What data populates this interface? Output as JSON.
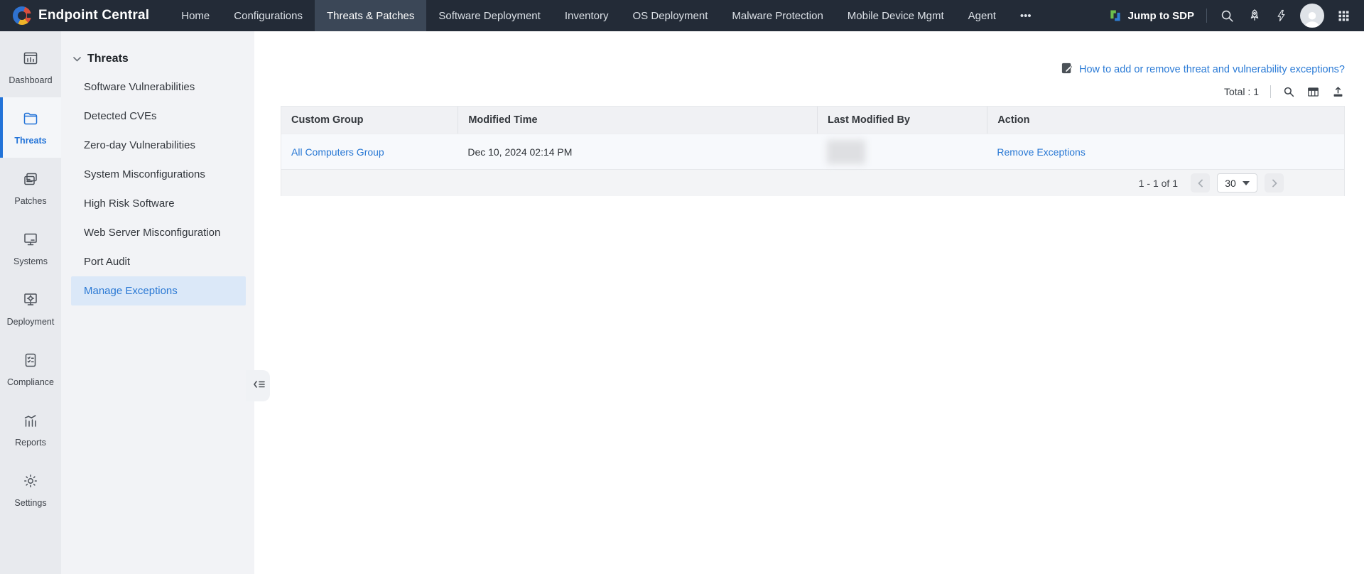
{
  "topnav": {
    "brand": "Endpoint Central",
    "items": [
      {
        "label": "Home",
        "active": false
      },
      {
        "label": "Configurations",
        "active": false
      },
      {
        "label": "Threats & Patches",
        "active": true
      },
      {
        "label": "Software Deployment",
        "active": false
      },
      {
        "label": "Inventory",
        "active": false
      },
      {
        "label": "OS Deployment",
        "active": false
      },
      {
        "label": "Malware Protection",
        "active": false
      },
      {
        "label": "Mobile Device Mgmt",
        "active": false
      },
      {
        "label": "Agent",
        "active": false
      },
      {
        "label": "•••",
        "active": false
      }
    ],
    "sdp_label": "Jump to SDP"
  },
  "rail": {
    "items": [
      {
        "label": "Dashboard",
        "active": false
      },
      {
        "label": "Threats",
        "active": true
      },
      {
        "label": "Patches",
        "active": false
      },
      {
        "label": "Systems",
        "active": false
      },
      {
        "label": "Deployment",
        "active": false
      },
      {
        "label": "Compliance",
        "active": false
      },
      {
        "label": "Reports",
        "active": false
      },
      {
        "label": "Settings",
        "active": false
      }
    ]
  },
  "sidebar": {
    "section_label": "Threats",
    "items": [
      {
        "label": "Software Vulnerabilities",
        "active": false
      },
      {
        "label": "Detected CVEs",
        "active": false
      },
      {
        "label": "Zero-day Vulnerabilities",
        "active": false
      },
      {
        "label": "System Misconfigurations",
        "active": false
      },
      {
        "label": "High Risk Software",
        "active": false
      },
      {
        "label": "Web Server Misconfiguration",
        "active": false
      },
      {
        "label": "Port Audit",
        "active": false
      },
      {
        "label": "Manage Exceptions",
        "active": true
      }
    ]
  },
  "main": {
    "help_link": "How to add or remove threat and vulnerability exceptions?",
    "total_label": "Total : 1",
    "table": {
      "columns": [
        "Custom Group",
        "Modified Time",
        "Last Modified By",
        "Action"
      ],
      "rows": [
        {
          "group": "All Computers Group",
          "modified": "Dec 10, 2024 02:14 PM",
          "modified_by_redacted": true,
          "action": "Remove Exceptions"
        }
      ]
    },
    "pagination": {
      "range_label": "1 - 1 of 1",
      "page_size": "30"
    }
  },
  "colors": {
    "accent_blue": "#2B7BD6",
    "nav_bg": "#232B37",
    "nav_active_bg": "#3B4757",
    "rail_bg": "#E8EAEE",
    "subnav_bg": "#F2F3F6",
    "selected_item_bg": "#DBE8F8",
    "sdp_green": "#6DBE4B",
    "sdp_blue": "#2E7DD1"
  }
}
